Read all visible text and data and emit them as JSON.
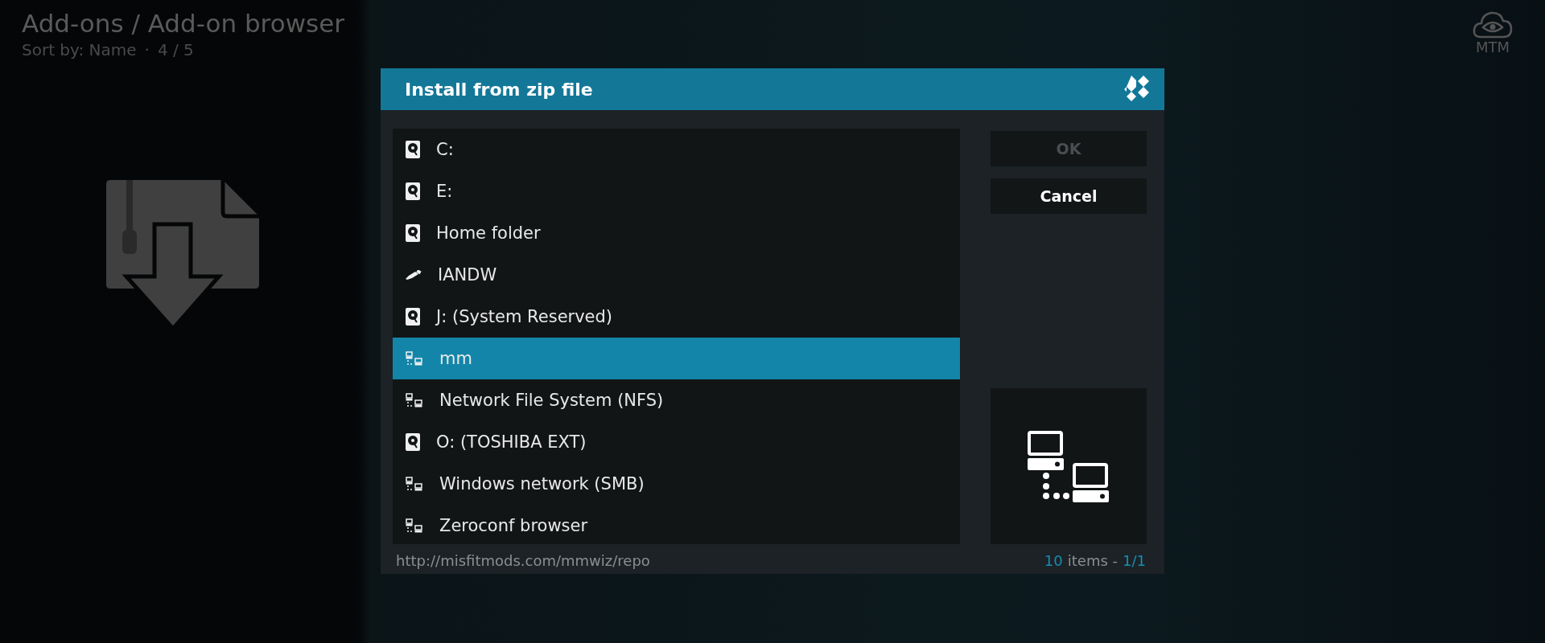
{
  "header": {
    "title": "Add-ons / Add-on browser",
    "sort_label": "Sort by: Name",
    "separator": "·",
    "position": "4 / 5"
  },
  "logo": {
    "text": "MTM"
  },
  "dialog": {
    "title": "Install from zip file",
    "items": [
      {
        "label": "C:",
        "kind": "drive",
        "selected": false
      },
      {
        "label": "E:",
        "kind": "drive",
        "selected": false
      },
      {
        "label": "Home folder",
        "kind": "drive",
        "selected": false
      },
      {
        "label": "IANDW",
        "kind": "usb",
        "selected": false
      },
      {
        "label": "J: (System Reserved)",
        "kind": "drive",
        "selected": false
      },
      {
        "label": "mm",
        "kind": "network",
        "selected": true
      },
      {
        "label": "Network File System (NFS)",
        "kind": "network",
        "selected": false
      },
      {
        "label": "O: (TOSHIBA EXT)",
        "kind": "drive",
        "selected": false
      },
      {
        "label": "Windows network (SMB)",
        "kind": "network",
        "selected": false
      },
      {
        "label": "Zeroconf browser",
        "kind": "network",
        "selected": false
      }
    ],
    "buttons": [
      {
        "label": "OK",
        "disabled": true
      },
      {
        "label": "Cancel",
        "disabled": false
      }
    ],
    "path": "http://misfitmods.com/mmwiz/repo",
    "count": "10",
    "count_label": "items -",
    "page": "1/1"
  }
}
